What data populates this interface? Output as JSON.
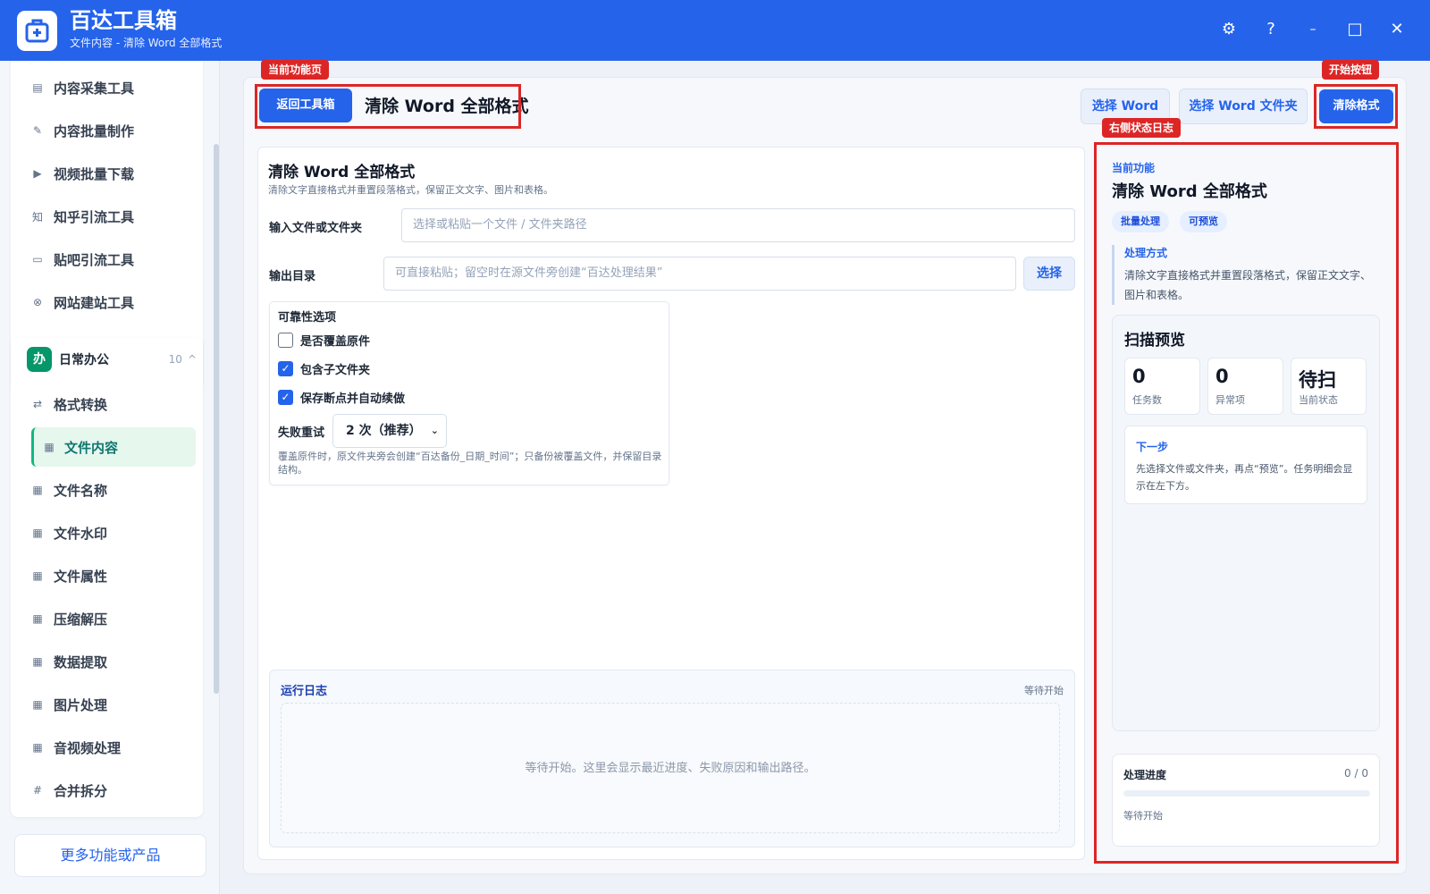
{
  "app": {
    "title": "百达工具箱",
    "subtitle": "文件内容 - 清除 Word 全部格式",
    "settings_icon": "⚙",
    "help_icon": "?",
    "minimize_icon": "–",
    "maximize_icon": "□",
    "close_icon": "✕"
  },
  "sidebar": {
    "top_items": [
      {
        "label": "内容采集工具",
        "icon": "▤"
      },
      {
        "label": "内容批量制作",
        "icon": "✎"
      },
      {
        "label": "视频批量下载",
        "icon": "▶"
      },
      {
        "label": "知乎引流工具",
        "icon": "知"
      },
      {
        "label": "贴吧引流工具",
        "icon": "▭"
      },
      {
        "label": "网站建站工具",
        "icon": "⊗"
      }
    ],
    "group": {
      "icon_char": "办",
      "label": "日常办公",
      "count": "10",
      "chevron": "^"
    },
    "group_items": [
      {
        "label": "格式转换",
        "icon": "⇄"
      },
      {
        "label": "文件内容",
        "icon": "▦"
      },
      {
        "label": "文件名称",
        "icon": "▦"
      },
      {
        "label": "文件水印",
        "icon": "▦"
      },
      {
        "label": "文件属性",
        "icon": "▦"
      },
      {
        "label": "压缩解压",
        "icon": "▦"
      },
      {
        "label": "数据提取",
        "icon": "▦"
      },
      {
        "label": "图片处理",
        "icon": "▦"
      },
      {
        "label": "音视频处理",
        "icon": "▦"
      },
      {
        "label": "合并拆分",
        "icon": "#"
      }
    ],
    "active_item": "文件内容",
    "more_button": "更多功能或产品"
  },
  "annotations": {
    "current_page": "当前功能页",
    "start_button": "开始按钮",
    "right_log": "右侧状态日志"
  },
  "toolbar": {
    "back_button": "返回工具箱",
    "page_title": "清除 Word 全部格式",
    "select_word": "选择 Word",
    "select_folder": "选择 Word 文件夹",
    "start": "清除格式"
  },
  "form": {
    "title": "清除 Word 全部格式",
    "description": "清除文字直接格式并重置段落格式，保留正文文字、图片和表格。",
    "input_label": "输入文件或文件夹",
    "input_placeholder": "选择或粘贴一个文件 / 文件夹路径",
    "output_label": "输出目录",
    "output_placeholder": "可直接粘贴；留空时在源文件旁创建“百达处理结果”",
    "output_select": "选择",
    "options_title": "可靠性选项",
    "options": [
      {
        "label": "是否覆盖原件",
        "checked": false
      },
      {
        "label": "包含子文件夹",
        "checked": true
      },
      {
        "label": "保存断点并自动续做",
        "checked": true
      }
    ],
    "check_mark": "✓",
    "retry_label": "失败重试",
    "retry_value": "2 次（推荐）",
    "retry_chevron": "⌄",
    "note": "覆盖原件时，原文件夹旁会创建“百达备份_日期_时间”；只备份被覆盖文件，并保留目录结构。"
  },
  "log": {
    "title": "运行日志",
    "status": "等待开始",
    "placeholder": "等待开始。这里会显示最近进度、失败原因和输出路径。"
  },
  "right_panel": {
    "label": "当前功能",
    "title": "清除 Word 全部格式",
    "badges": [
      "批量处理",
      "可预览"
    ],
    "method_title": "处理方式",
    "method_desc": "清除文字直接格式并重置段落格式，保留正文文字、图片和表格。",
    "scan_title": "扫描预览",
    "stats": [
      {
        "value": "0",
        "label": "任务数"
      },
      {
        "value": "0",
        "label": "异常项"
      },
      {
        "value": "待扫",
        "label": "当前状态"
      }
    ],
    "next_title": "下一步",
    "next_desc": "先选择文件或文件夹，再点“预览”。任务明细会显示在左下方。",
    "progress_title": "处理进度",
    "progress_count": "0 / 0",
    "progress_fraction": 0,
    "progress_status": "等待开始"
  },
  "colors": {
    "primary": "#2563eb",
    "annotation": "#dc2626",
    "active_green": "#10b981"
  }
}
